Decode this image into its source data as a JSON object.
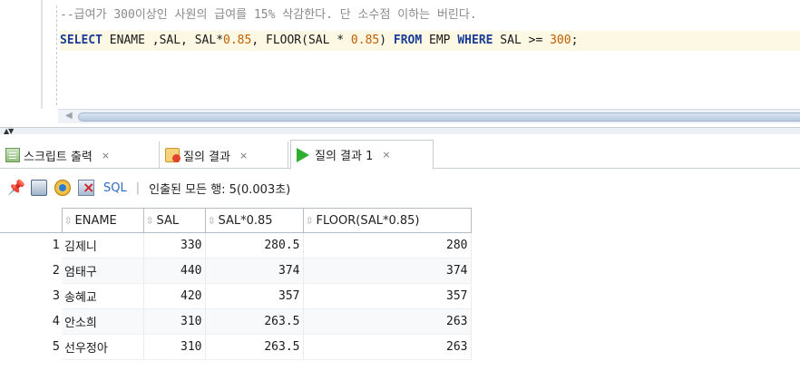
{
  "editor": {
    "comment_line": "--급여가 300이상인 사원의 급여를 15% 삭감한다. 단 소수점 이하는 버린다.",
    "sql_tokens": [
      {
        "t": "SELECT",
        "k": "kw"
      },
      {
        "t": " ENAME ,SAL, SAL*",
        "k": "plain"
      },
      {
        "t": "0.85",
        "k": "num"
      },
      {
        "t": ", FLOOR(SAL * ",
        "k": "plain"
      },
      {
        "t": "0.85",
        "k": "num"
      },
      {
        "t": ") ",
        "k": "plain"
      },
      {
        "t": "FROM",
        "k": "kw"
      },
      {
        "t": " EMP ",
        "k": "plain"
      },
      {
        "t": "WHERE",
        "k": "kw"
      },
      {
        "t": " SAL >= ",
        "k": "plain"
      },
      {
        "t": "300",
        "k": "num"
      },
      {
        "t": ";",
        "k": "plain"
      }
    ]
  },
  "tabs": [
    {
      "label": "스크립트 출력",
      "close": "×",
      "icon": "script-output-icon"
    },
    {
      "label": "질의 결과",
      "close": "×",
      "icon": "query-result-icon"
    },
    {
      "label": "질의 결과 1",
      "close": "×",
      "icon": "run-icon",
      "active": true
    }
  ],
  "toolbar": {
    "sql_label": "SQL",
    "separator": "|",
    "status": "인출된 모든 행: 5(0.003초)"
  },
  "grid": {
    "sort_glyph": "⇳",
    "columns": [
      "ENAME",
      "SAL",
      "SAL*0.85",
      "FLOOR(SAL*0.85)"
    ],
    "rows": [
      {
        "n": "1",
        "ename": "김제니",
        "sal": "330",
        "sal085": "280.5",
        "floor": "280"
      },
      {
        "n": "2",
        "ename": "엄태구",
        "sal": "440",
        "sal085": "374",
        "floor": "374"
      },
      {
        "n": "3",
        "ename": "송혜교",
        "sal": "420",
        "sal085": "357",
        "floor": "357"
      },
      {
        "n": "4",
        "ename": "안소희",
        "sal": "310",
        "sal085": "263.5",
        "floor": "263"
      },
      {
        "n": "5",
        "ename": "선우정아",
        "sal": "310",
        "sal085": "263.5",
        "floor": "263"
      }
    ]
  }
}
